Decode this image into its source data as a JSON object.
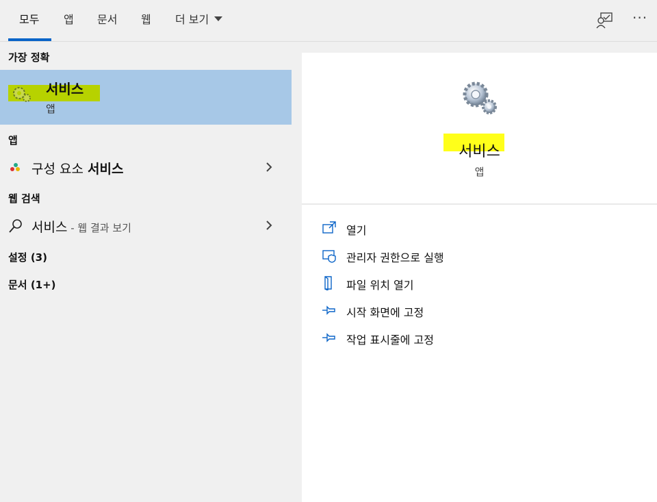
{
  "tabs": [
    {
      "label": "모두",
      "active": true
    },
    {
      "label": "앱"
    },
    {
      "label": "문서"
    },
    {
      "label": "웹"
    },
    {
      "label": "더 보기"
    }
  ],
  "top_icons": [
    "feedback-icon",
    "more-options-icon"
  ],
  "more_options_glyph": "···",
  "left": {
    "best_match_header": "가장 정확",
    "best_match": {
      "title": "서비스",
      "subtitle": "앱",
      "icon": "gears-icon"
    },
    "apps_header": "앱",
    "apps": [
      {
        "prefix": "구성 요소 ",
        "bold": "서비스",
        "icon": "component-services-icon"
      }
    ],
    "web_header": "웹 검색",
    "web": [
      {
        "query": "서비스",
        "suffix": " - 웹 결과 보기",
        "icon": "search-icon"
      }
    ],
    "settings_header": "설정 (3)",
    "documents_header": "문서 (1+)"
  },
  "right": {
    "app_name": "서비스",
    "app_type": "앱",
    "actions": [
      {
        "label": "열기",
        "icon": "open-icon"
      },
      {
        "label": "관리자 권한으로 실행",
        "icon": "admin-shield-icon"
      },
      {
        "label": "파일 위치 열기",
        "icon": "file-location-icon"
      },
      {
        "label": "시작 화면에 고정",
        "icon": "pin-icon"
      },
      {
        "label": "작업 표시줄에 고정",
        "icon": "pin-icon"
      }
    ]
  },
  "colors": {
    "accent": "#0a64c8",
    "selection": "#a7c8e7",
    "highlight_green": "#b7d200",
    "highlight_yellow": "#ffff1a"
  }
}
